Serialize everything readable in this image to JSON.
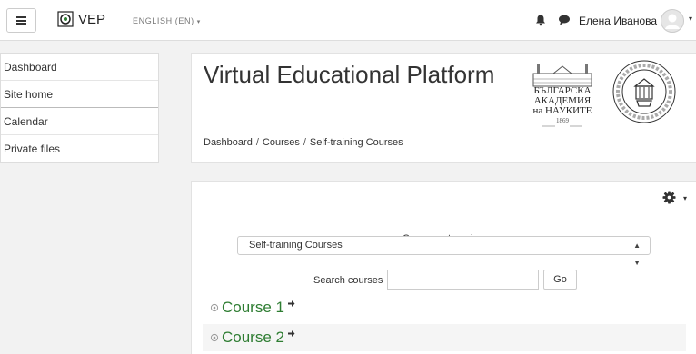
{
  "navbar": {
    "brand": "VEP",
    "language": "ENGLISH (EN)",
    "user_name": "Елена Иванова"
  },
  "sidebar": {
    "items": [
      {
        "label": "Dashboard"
      },
      {
        "label": "Site home"
      },
      {
        "label": "Calendar"
      },
      {
        "label": "Private files"
      }
    ]
  },
  "header": {
    "title": "Virtual Educational Platform",
    "academy_logo": {
      "line1": "БЪЛГАРСКА",
      "line2": "АКАДЕМИЯ",
      "line3": "на НАУКИТЕ",
      "year": "1869"
    },
    "breadcrumb": [
      "Dashboard",
      "Courses",
      "Self-training Courses"
    ]
  },
  "main": {
    "categories_label": "Course categories:",
    "selected_category": "Self-training Courses",
    "search_label": "Search courses",
    "search_value": "",
    "go_label": "Go",
    "courses": [
      {
        "title": "Course 1"
      },
      {
        "title": "Course 2"
      }
    ]
  },
  "colors": {
    "course_link": "#2e7d32",
    "page_background": "#f2f2f2"
  },
  "icons": [
    "menu-icon",
    "vep-logo-icon",
    "bell-icon",
    "chat-icon",
    "avatar-icon",
    "gear-icon",
    "course-bullet-icon",
    "enrol-icon"
  ]
}
